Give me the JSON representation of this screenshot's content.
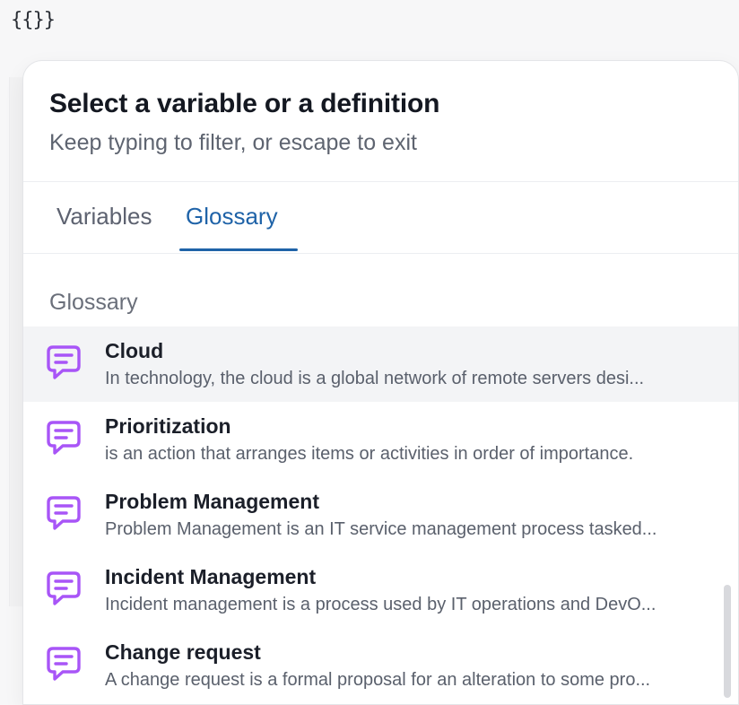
{
  "editor": {
    "token": "{{}}"
  },
  "popover": {
    "title": "Select a variable or a definition",
    "subtitle": "Keep typing to filter, or escape to exit",
    "tabs": [
      {
        "label": "Variables",
        "active": false
      },
      {
        "label": "Glossary",
        "active": true
      }
    ],
    "section_label": "Glossary",
    "items": [
      {
        "name": "Cloud",
        "description": "In technology, the cloud is a global network of remote servers desi...",
        "icon": "message-square-lines-icon",
        "highlighted": true
      },
      {
        "name": "Prioritization",
        "description": "is an action that arranges items or activities in order of importance.",
        "icon": "message-square-lines-icon",
        "highlighted": false
      },
      {
        "name": "Problem Management",
        "description": "Problem Management is an IT service management process tasked...",
        "icon": "message-square-lines-icon",
        "highlighted": false
      },
      {
        "name": "Incident Management",
        "description": "Incident management is a process used by IT operations and DevO...",
        "icon": "message-square-lines-icon",
        "highlighted": false
      },
      {
        "name": "Change request",
        "description": "A change request is a formal proposal for an alteration to some pro...",
        "icon": "message-square-lines-icon",
        "highlighted": false
      }
    ]
  },
  "colors": {
    "accent": "#1f63a8",
    "icon": "#a855f7",
    "highlight_row": "#f3f4f6"
  }
}
